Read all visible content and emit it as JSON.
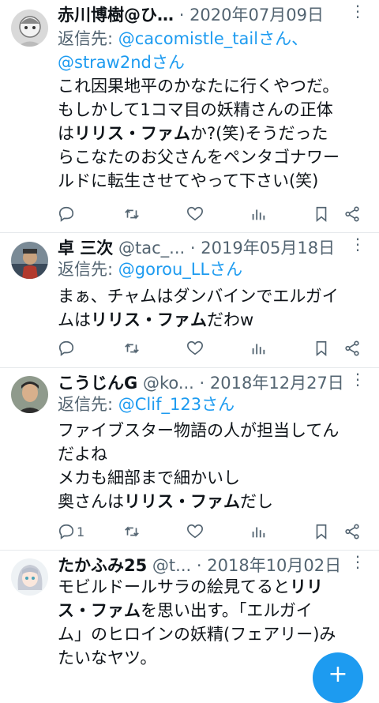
{
  "tweets": [
    {
      "name": "赤川博樹@ひ…",
      "handle": "",
      "date": "2020年07月09日",
      "reply_prefix": "返信先: ",
      "reply_mentions": "@cacomistle_tailさん、",
      "reply_mentions_2": "@straw2ndさん",
      "body": [
        {
          "t": "これ因果地平のかなたに行くやつだ。\nもしかして1コマ目の妖精さんの正体\nは",
          "b": false
        },
        {
          "t": "リリス・ファム",
          "b": true
        },
        {
          "t": "か?(笑)そうだった\nらこなたのお父さんをペンタゴナワー\nルドに転生させてやって下さい(笑)",
          "b": false
        }
      ],
      "reply_count": ""
    },
    {
      "name": "卓 三次",
      "handle": "@tac_...",
      "date": "2019年05月18日",
      "reply_prefix": "返信先: ",
      "reply_mentions": "@gorou_LLさん",
      "body": [
        {
          "t": "まぁ、チャムはダンバインでエルガイ\nムは",
          "b": false
        },
        {
          "t": "リリス・ファム",
          "b": true
        },
        {
          "t": "だわw",
          "b": false
        }
      ],
      "reply_count": ""
    },
    {
      "name": "こうじんG",
      "handle": "@ko...",
      "date": "2018年12月27日",
      "reply_prefix": "返信先: ",
      "reply_mentions": "@Clif_123さん",
      "body": [
        {
          "t": "ファイブスター物語の人が担当してん\nだよね\nメカも細部まで細かいし\n奥さんは",
          "b": false
        },
        {
          "t": "リリス・ファム",
          "b": true
        },
        {
          "t": "だし",
          "b": false
        }
      ],
      "reply_count": "1"
    },
    {
      "name": "たかふみ25",
      "handle": "@t...",
      "date": "2018年10月02日",
      "body": [
        {
          "t": "モビルドールサラの絵見てると",
          "b": false
        },
        {
          "t": "リリ\nス・ファム",
          "b": true
        },
        {
          "t": "を思い出す。「エルガイ\nム」のヒロインの妖精(フェアリー)み\nたいなヤツ。",
          "b": false
        }
      ],
      "reply_count": ""
    }
  ],
  "icons": {
    "reply": "reply-icon",
    "retweet": "retweet-icon",
    "like": "heart-icon",
    "views": "views-icon",
    "bookmark": "bookmark-icon",
    "share": "share-icon",
    "more": "more-icon",
    "compose": "compose-icon"
  },
  "dot": "·",
  "more_glyph": "⋮",
  "compose_glyph": "+",
  "colors": {
    "accent": "#1d9bf0",
    "muted": "#536471",
    "text": "#0f1419"
  }
}
